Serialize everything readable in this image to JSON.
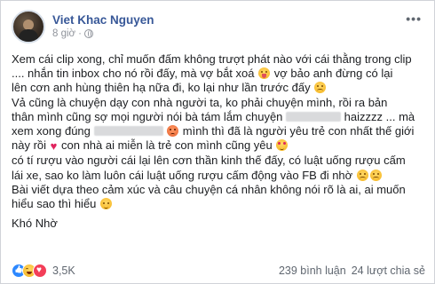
{
  "post": {
    "author": "Viet Khac Nguyen",
    "time": "8 giờ",
    "separator": "·",
    "more": "•••",
    "lines": [
      [
        "Xem cái clip xong, chỉ muốn đấm không trượt phát nào với cái thằng trong clip"
      ],
      [
        ".... nhắn tin inbox cho nó rồi đấy, mà vợ bắt xoá",
        "vợ bảo anh đừng có lại"
      ],
      [
        "lên cơn anh hùng thiên hạ nữa đi, ko lại như lần trước đấy"
      ],
      [
        "Vả cũng là chuyện dạy con nhà người ta, ko phải chuyện mình, rồi ra bản"
      ],
      [
        "thân mình cũng sợ mọi người nói bà tám lắm chuyện",
        "haizzzz ... mà"
      ],
      [
        "xem xong đúng",
        "mình thì đã là người yêu trẻ con nhất thế giới"
      ],
      [
        "này rồi",
        "con nhà ai miễn là trẻ con mình cũng yêu"
      ],
      [
        "có tí rượu vào người cái lại lên cơn thần kinh thế đấy, có luật uống rượu cấm"
      ],
      [
        "lái xe, sao ko làm luôn cái luật uống rượu cấm động vào FB đi nhờ"
      ],
      [
        "Bài viết dựa theo cảm xúc và câu chuyện cá nhân không nói rõ là ai, ai muốn"
      ],
      [
        "hiểu sao thì hiểu"
      ],
      [
        "Khó Nhờ"
      ]
    ]
  },
  "footer": {
    "reaction_count": "3,5K",
    "comments": "239 bình luận",
    "shares": "24 lượt chia sẻ"
  },
  "icons": {
    "reactions": [
      "like-icon",
      "haha-icon",
      "love-icon"
    ],
    "emoji_inline": [
      "tongue-emoji-icon",
      "sad-emoji-icon",
      "angry-emoji-icon",
      "heart-icon",
      "love-emoji-icon",
      "sad-emoji-icon",
      "sweat-emoji-icon"
    ]
  },
  "colors": {
    "name": "#385898",
    "meta": "#90949c",
    "like": "#2d88ff",
    "love": "#f33e58"
  }
}
